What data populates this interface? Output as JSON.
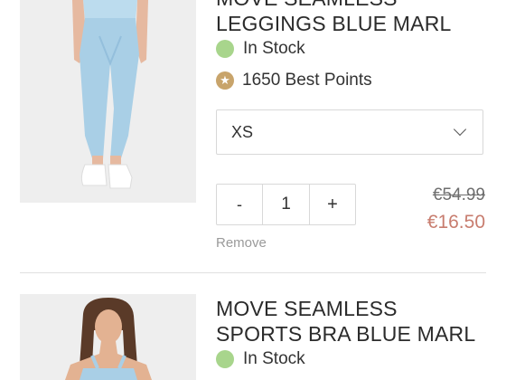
{
  "cart": {
    "items": [
      {
        "title": "MOVE SEAMLESS LEGGINGS BLUE MARL",
        "stock": "In Stock",
        "points_icon": "star-icon",
        "points": "1650 Best Points",
        "size": "XS",
        "quantity": "1",
        "minus_label": "-",
        "plus_label": "+",
        "remove_label": "Remove",
        "old_price": "€54.99",
        "new_price": "€16.50"
      },
      {
        "title": "MOVE SEAMLESS SPORTS BRA BLUE MARL",
        "stock": "In Stock"
      }
    ]
  },
  "colors": {
    "stock_dot": "#a8d58c",
    "points_badge": "#c8a46b",
    "sale_price": "#c87d6f",
    "product_blue": "#a9cfe6"
  }
}
